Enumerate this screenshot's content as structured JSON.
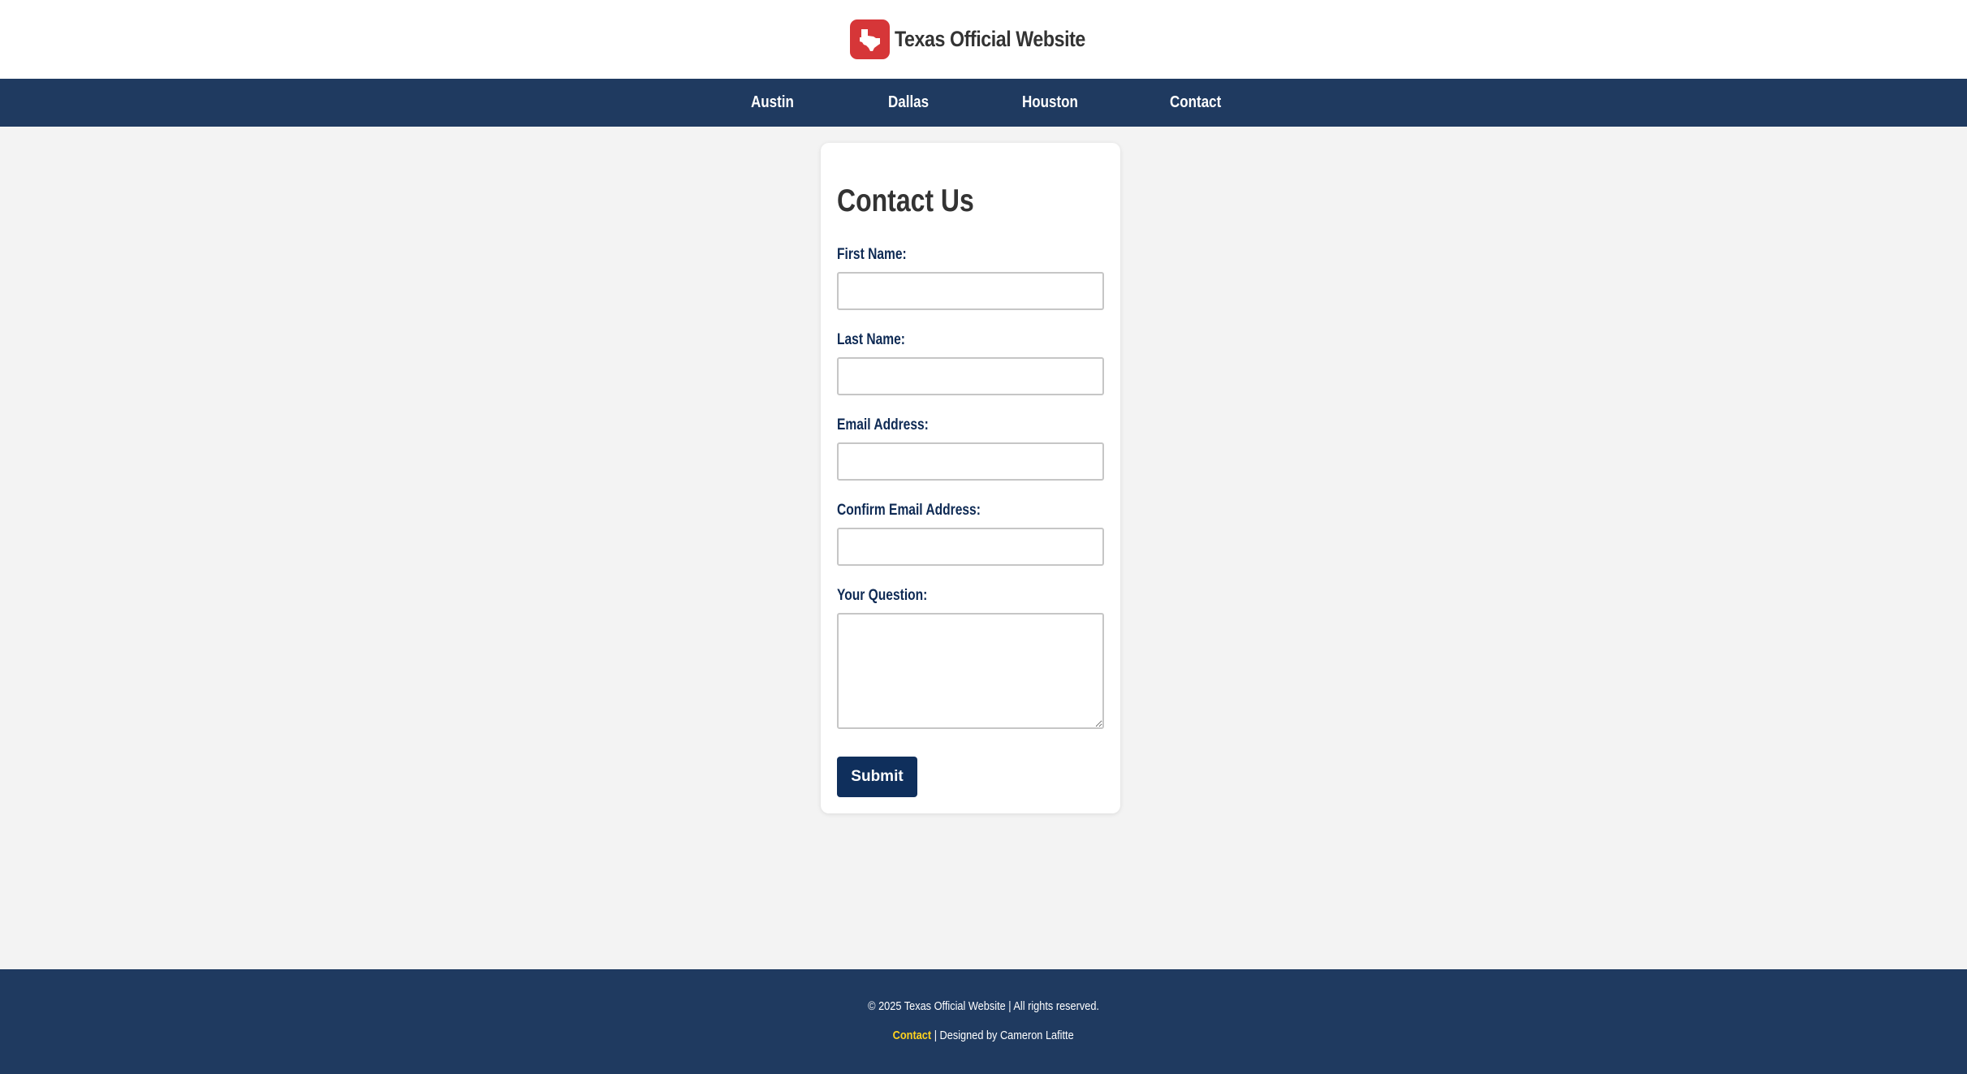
{
  "header": {
    "logo_icon": "texas-state-icon",
    "title": "Texas Official Website",
    "logo_color": "#d63638"
  },
  "nav": {
    "items": [
      {
        "label": "Austin"
      },
      {
        "label": "Dallas"
      },
      {
        "label": "Houston"
      },
      {
        "label": "Contact"
      }
    ],
    "background": "#1f3a60"
  },
  "form": {
    "title": "Contact Us",
    "fields": [
      {
        "label": "First Name:",
        "value": "",
        "placeholder": ""
      },
      {
        "label": "Last Name:",
        "value": "",
        "placeholder": ""
      },
      {
        "label": "Email Address:",
        "value": "",
        "placeholder": ""
      },
      {
        "label": "Confirm Email Address:",
        "value": "",
        "placeholder": ""
      }
    ],
    "question": {
      "label": "Your Question:",
      "value": "",
      "placeholder": ""
    },
    "submit_label": "Submit",
    "label_color": "#0e2a54",
    "button_color": "#0f2f5c"
  },
  "footer": {
    "copyright": "© 2025 Texas Official Website | All rights reserved.",
    "contact_link": "Contact",
    "designed_by": "| Designed by Cameron Lafitte",
    "link_color": "#ffd21f"
  }
}
